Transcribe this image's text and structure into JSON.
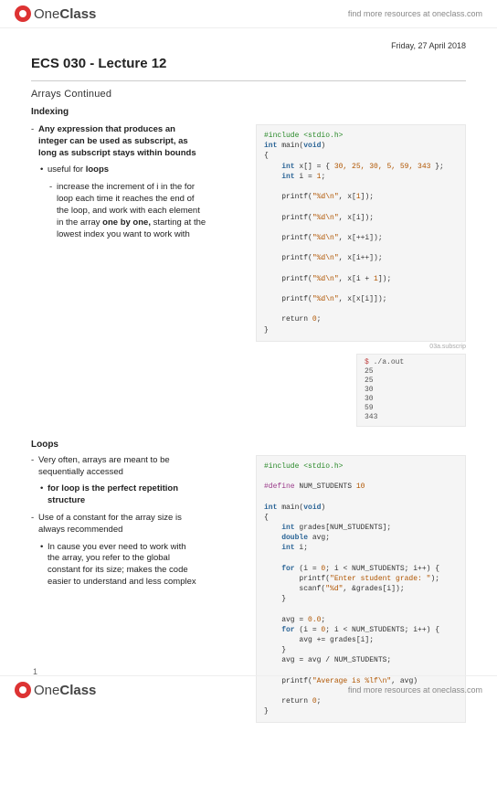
{
  "brand": {
    "name1": "One",
    "name2": "Class",
    "tagline": "find more resources at oneclass.com"
  },
  "date": "Friday, 27 April 2018",
  "title": "ECS 030 - Lecture 12",
  "subtitle": "Arrays Continued",
  "indexing": {
    "heading": "Indexing",
    "b1a": "Any expression that produces an",
    "b1b": "integer can be used as subscript, as",
    "b1c": "long as subscript stays within bounds",
    "b2": "useful for ",
    "b2bold": "loops",
    "b3a": "increase the increment of i in the for",
    "b3b": "loop each time it reaches the end of",
    "b3c": "the loop, and work with each element",
    "b3d": "in the array ",
    "b3dbold": "one by one, ",
    "b3e": "starting at the",
    "b3f": "lowest index you want to work with"
  },
  "code1": {
    "l1a": "#include",
    "l1b": " <stdio.h>",
    "l2a": "int",
    "l2b": " main(",
    "l2c": "void",
    "l2d": ")",
    "l3": "{",
    "l4a": "    int",
    "l4b": " x[] = { ",
    "l4c": "30, 25, 30, 5, 59, 343",
    "l4d": " };",
    "l5a": "    int",
    "l5b": " i = ",
    "l5c": "1",
    "l5d": ";",
    "l6a": "    printf(",
    "l6b": "\"%d\\n\"",
    "l6c": ", x[",
    "l6d": "1",
    "l6e": "]);",
    "l7a": "    printf(",
    "l7b": "\"%d\\n\"",
    "l7c": ", x[i]);",
    "l8a": "    printf(",
    "l8b": "\"%d\\n\"",
    "l8c": ", x[++i]);",
    "l9a": "    printf(",
    "l9b": "\"%d\\n\"",
    "l9c": ", x[i++]);",
    "l10a": "    printf(",
    "l10b": "\"%d\\n\"",
    "l10c": ", x[i + ",
    "l10d": "1",
    "l10e": "]);",
    "l11a": "    printf(",
    "l11b": "\"%d\\n\"",
    "l11c": ", x[x[i]]);",
    "l12a": "    return ",
    "l12b": "0",
    "l12c": ";",
    "l13": "}",
    "caption": "03a.subscrip"
  },
  "output1": {
    "prompt": "$ ",
    "cmd": "./a.out",
    "o1": "25",
    "o2": "25",
    "o3": "30",
    "o4": "30",
    "o5": "59",
    "o6": "343"
  },
  "loops": {
    "heading": "Loops",
    "b1a": "Very often, arrays are meant to be",
    "b1b": "sequentially accessed",
    "b2a": "for loop is the perfect repetition",
    "b2b": "structure",
    "b3a": "Use of a constant for the array size is",
    "b3b": "always recommended",
    "b4a": "In cause you ever need to work with",
    "b4b": "the array, you refer to the global",
    "b4c": "constant for its size; makes the code",
    "b4d": "easier to understand and less complex"
  },
  "code2": {
    "l1a": "#include",
    "l1b": " <stdio.h>",
    "l2a": "#define",
    "l2b": " NUM_STUDENTS ",
    "l2c": "10",
    "l3a": "int",
    "l3b": " main(",
    "l3c": "void",
    "l3d": ")",
    "l4": "{",
    "l5a": "    int",
    "l5b": " grades[NUM_STUDENTS];",
    "l6a": "    double",
    "l6b": " avg;",
    "l7a": "    int",
    "l7b": " i;",
    "l8a": "    for",
    "l8b": " (i = ",
    "l8c": "0",
    "l8d": "; i < NUM_STUDENTS; i++) {",
    "l9a": "        printf(",
    "l9b": "\"Enter student grade: \"",
    "l9c": ");",
    "l10a": "        scanf(",
    "l10b": "\"%d\"",
    "l10c": ", &grades[i]);",
    "l11": "    }",
    "l12a": "    avg = ",
    "l12b": "0.0",
    "l12c": ";",
    "l13a": "    for",
    "l13b": " (i = ",
    "l13c": "0",
    "l13d": "; i < NUM_STUDENTS; i++) {",
    "l14": "        avg += grades[i];",
    "l15": "    }",
    "l16": "    avg = avg / NUM_STUDENTS;",
    "l17a": "    printf(",
    "l17b": "\"Average is %lf\\n\"",
    "l17c": ", avg)",
    "l18a": "    return ",
    "l18b": "0",
    "l18c": ";",
    "l19": "}"
  },
  "pagenum": "1"
}
